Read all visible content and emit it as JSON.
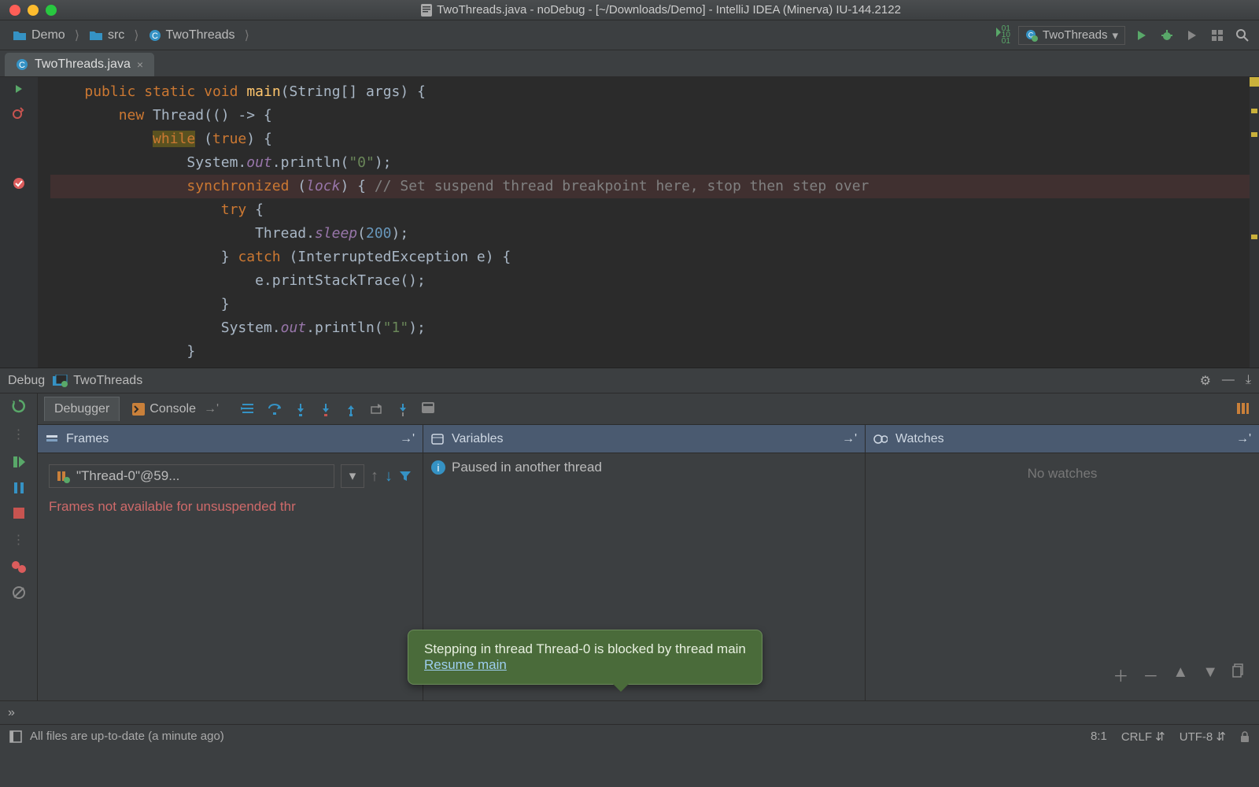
{
  "window_title": "TwoThreads.java - noDebug - [~/Downloads/Demo] - IntelliJ IDEA (Minerva) IU-144.2122",
  "breadcrumbs": {
    "project": "Demo",
    "folder": "src",
    "class": "TwoThreads"
  },
  "run_config": "TwoThreads",
  "editor_tab": {
    "name": "TwoThreads.java"
  },
  "code": {
    "l1a": "public",
    "l1b": "static",
    "l1c": "void",
    "l1d": "main",
    "l1e": "(String[] args) {",
    "l2a": "new",
    "l2b": " Thread(() -> {",
    "l3a": "while",
    "l3b": " (",
    "l3c": "true",
    "l3d": ") {",
    "l4a": "System.",
    "l4b": "out",
    "l4c": ".println(",
    "l4d": "\"0\"",
    "l4e": ");",
    "l5a": "synchronized",
    "l5b": " (",
    "l5c": "lock",
    "l5d": ") { ",
    "l5e": "// Set suspend thread breakpoint here, stop then step over",
    "l6a": "try",
    "l6b": " {",
    "l7a": "Thread.",
    "l7b": "sleep",
    "l7c": "(",
    "l7d": "200",
    "l7e": ");",
    "l8a": "} ",
    "l8b": "catch",
    "l8c": " (InterruptedException e) {",
    "l9": "e.printStackTrace();",
    "l10": "}",
    "l11a": "System.",
    "l11b": "out",
    "l11c": ".println(",
    "l11d": "\"1\"",
    "l11e": ");",
    "l12": "}"
  },
  "debug_tw": {
    "title": "Debug",
    "config": "TwoThreads"
  },
  "dbg_tabs": {
    "debugger": "Debugger",
    "console": "Console"
  },
  "frames": {
    "title": "Frames",
    "thread": "\"Thread-0\"@59...",
    "message": "Frames not available for unsuspended thr"
  },
  "variables": {
    "title": "Variables",
    "message": "Paused in another thread"
  },
  "watches": {
    "title": "Watches",
    "empty": "No watches"
  },
  "notification": {
    "text": "Stepping in thread Thread-0 is blocked by thread main",
    "link": "Resume main"
  },
  "statusbar": {
    "msg": "All files are up-to-date (a minute ago)",
    "pos": "8:1",
    "lineend": "CRLF",
    "encoding": "UTF-8"
  }
}
